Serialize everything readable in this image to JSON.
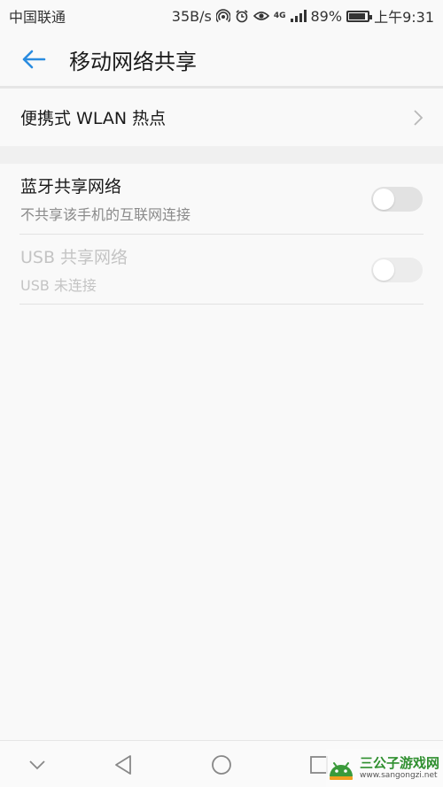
{
  "status_bar": {
    "carrier": "中国联通",
    "net_speed": "35B/s",
    "network_type": "4G",
    "battery_level": 0.89,
    "battery_text": "89%",
    "time": "上午9:31"
  },
  "header": {
    "title": "移动网络共享"
  },
  "hotspot": {
    "label": "便携式 WLAN 热点"
  },
  "bluetooth": {
    "title": "蓝牙共享网络",
    "subtitle": "不共享该手机的互联网连接",
    "enabled": false
  },
  "usb": {
    "title": "USB 共享网络",
    "subtitle": "USB 未连接",
    "enabled": false,
    "disabled": true
  },
  "watermark": {
    "title": "三公子游戏网",
    "url": "www.sangongzi.net"
  },
  "colors": {
    "accent": "#2a8ce0",
    "background": "#f9f9f9",
    "text_primary": "#1a1a1a",
    "text_secondary": "#8a8a8a",
    "text_disabled": "#c4c4c4"
  },
  "icons": [
    "arrow-left-icon",
    "chevron-right-icon",
    "hotspot-icon",
    "alarm-icon",
    "eye-icon",
    "signal-icon",
    "battery-icon",
    "chevron-down-icon",
    "back-triangle-icon",
    "home-circle-icon",
    "recents-square-icon"
  ]
}
